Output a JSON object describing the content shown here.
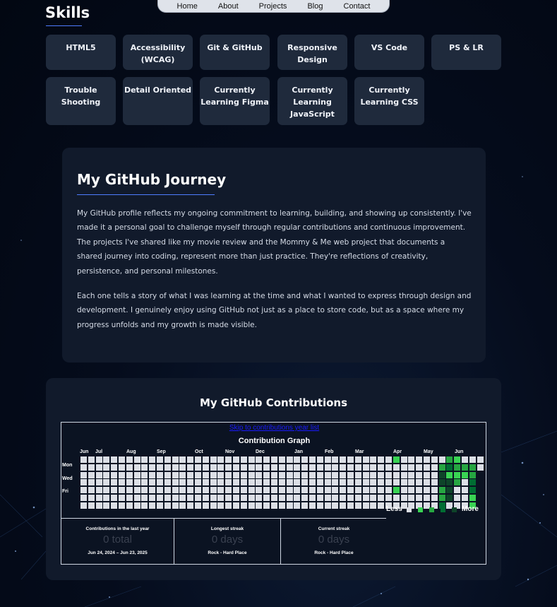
{
  "nav": {
    "items": [
      "Home",
      "About",
      "Projects",
      "Blog",
      "Contact"
    ]
  },
  "skills": {
    "title": "Skills",
    "row1": [
      "HTML5",
      "Accessibility (WCAG)",
      "Git & GitHub",
      "Responsive Design",
      "VS Code",
      "PS & LR"
    ],
    "row2": [
      "Trouble Shooting",
      "Detail Oriented",
      "Currently Learning Figma",
      "Currently Learning JavaScript",
      "Currently Learning CSS"
    ]
  },
  "journey": {
    "title": "My GitHub Journey",
    "p1": "My GitHub profile reflects my ongoing commitment to learning, building, and showing up consistently. I've made it a personal goal to challenge myself through regular contributions and continuous improvement. The projects I've shared like my movie review and the Mommy & Me web project that documents a shared journey into coding, represent more than just practice. They're reflections of creativity, persistence, and personal milestones.",
    "p2": "Each one tells a story of what I was learning at the time and what I wanted to express through design and development. I genuinely enjoy using GitHub not just as a place to store code, but as a space where my progress unfolds and my growth is made visible."
  },
  "contributions": {
    "title": "My GitHub Contributions",
    "skip_link": "Skip to contributions year list",
    "graph_title": "Contribution Graph",
    "months": [
      "Jun",
      "Jul",
      "Aug",
      "Sep",
      "Oct",
      "Nov",
      "Dec",
      "Jan",
      "Feb",
      "Mar",
      "Apr",
      "May",
      "Jun"
    ],
    "days": [
      "Mon",
      "Wed",
      "Fri"
    ],
    "legend_less": "Less",
    "legend_more": "More",
    "colors": {
      "empty": "#dcdfe6",
      "l1": "#39d353",
      "l2": "#26a641",
      "l3": "#006d32",
      "l4": "#0e4429"
    },
    "stats": [
      {
        "label": "Contributions in the last year",
        "value": "0 total",
        "range": "Jun 24, 2024 – Jun 23, 2025"
      },
      {
        "label": "Longest streak",
        "value": "0 days",
        "range": "Rock - Hard Place"
      },
      {
        "label": "Current streak",
        "value": "0 days",
        "range": "Rock - Hard Place"
      }
    ]
  }
}
